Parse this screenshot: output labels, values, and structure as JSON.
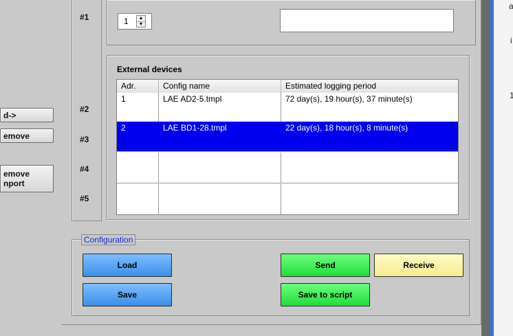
{
  "left_buttons": [
    "d->",
    "emove",
    "emove",
    "nport"
  ],
  "row_numbers": [
    "#1",
    "#2",
    "#3",
    "#4",
    "#5"
  ],
  "spinner": {
    "value": "1"
  },
  "external_devices": {
    "title": "External devices",
    "columns": [
      "Adr.",
      "Config name",
      "Estimated logging period"
    ],
    "rows": [
      {
        "adr": "1",
        "config": "LAE AD2-5.tmpl",
        "period": "72 day(s), 19 hour(s), 37 minute(s)",
        "selected": false
      },
      {
        "adr": "2",
        "config": "LAE BD1-28.tmpl",
        "period": "22 day(s), 18 hour(s), 8 minute(s)",
        "selected": true
      },
      {
        "adr": "",
        "config": "",
        "period": "",
        "selected": false
      },
      {
        "adr": "",
        "config": "",
        "period": "",
        "selected": false
      }
    ]
  },
  "configuration": {
    "title": "Configuration",
    "load": "Load",
    "save": "Save",
    "send": "Send",
    "receive": "Receive",
    "save_to_script": "Save to script"
  },
  "right_edge_chars": [
    "a",
    "i",
    "1"
  ],
  "colors": {
    "selection": "#0000ee",
    "blue_button": "#4a9af0",
    "green_button": "#2ee24a",
    "yellow_button": "#fbf0a4",
    "config_label": "#0a2bd6"
  }
}
